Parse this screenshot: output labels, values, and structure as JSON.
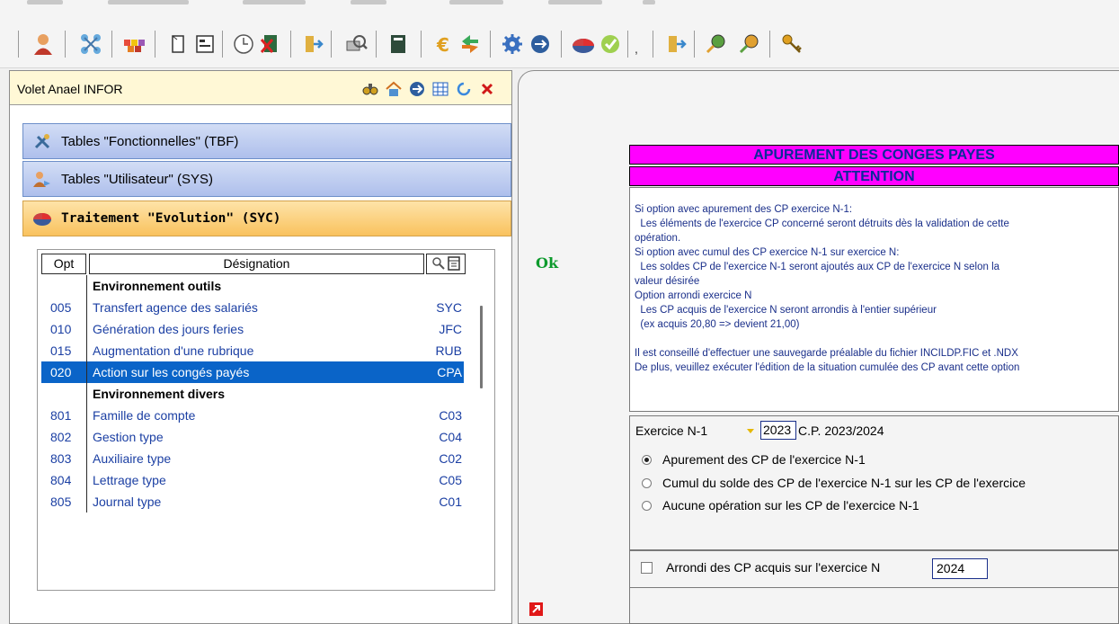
{
  "toolbar": {
    "icons": [
      "user-icon",
      "network-icon",
      "puzzle-icon",
      "document-icon",
      "form-icon",
      "clock-icon",
      "delete-file-icon",
      "export-icon",
      "print-preview-icon",
      "book-icon",
      "euro-icon",
      "arrows-icon",
      "gear-icon",
      "globe-icon",
      "pie-chart-icon",
      "check-icon",
      "export-icon-2",
      "key-magnify-icon",
      "key-magnify-icon-2",
      "key-icon"
    ],
    "comma": ","
  },
  "left_pane": {
    "title": "Volet Anael INFOR",
    "sections": [
      {
        "label": "Tables \"Fonctionnelles\" (TBF)",
        "icon": "tools-icon"
      },
      {
        "label": "Tables \"Utilisateur\" (SYS)",
        "icon": "users-icon"
      },
      {
        "label": "Traitement \"Evolution\" (SYC)",
        "icon": "pie-chart-icon"
      }
    ],
    "grid": {
      "headers": {
        "opt": "Opt",
        "designation": "Désignation"
      },
      "rows": [
        {
          "opt": "",
          "designation": "Environnement outils",
          "code": "",
          "group": true
        },
        {
          "opt": "005",
          "designation": "Transfert agence des salariés",
          "code": "SYC"
        },
        {
          "opt": "010",
          "designation": "Génération des jours feries",
          "code": "JFC"
        },
        {
          "opt": "015",
          "designation": "Augmentation d'une rubrique",
          "code": "RUB"
        },
        {
          "opt": "020",
          "designation": "Action sur les congés payés",
          "code": "CPA",
          "selected": true
        },
        {
          "opt": "",
          "designation": "Environnement divers",
          "code": "",
          "group": true
        },
        {
          "opt": "801",
          "designation": "Famille de compte",
          "code": "C03"
        },
        {
          "opt": "802",
          "designation": "Gestion type",
          "code": "C04"
        },
        {
          "opt": "803",
          "designation": "Auxiliaire type",
          "code": "C02"
        },
        {
          "opt": "804",
          "designation": "Lettrage type",
          "code": "C05"
        },
        {
          "opt": "805",
          "designation": "Journal type",
          "code": "C01"
        }
      ]
    }
  },
  "right_pane": {
    "ok_label": "Ok",
    "title": "APUREMENT DES CONGES PAYES",
    "attention": "ATTENTION",
    "info_lines": [
      "Si option avec apurement des CP exercice N-1:",
      "  Les éléments de l'exercice CP concerné seront détruits dès la validation de cette",
      "opération.",
      "Si option avec cumul des CP exercice N-1 sur exercice N:",
      "  Les soldes CP de l'exercice N-1 seront ajoutés aux CP de l'exercice N selon la",
      "valeur désirée",
      "Option arrondi exercice N",
      "  Les CP acquis de l'exercice N seront arrondis à l'entier supérieur",
      "  (ex acquis 20,80 => devient 21,00)",
      "",
      "Il est conseillé d'effectuer une sauvegarde préalable du fichier INCILDP.FIC et .NDX",
      "De plus, veuillez exécuter l'édition de la situation cumulée des CP avant cette option"
    ],
    "exercice": {
      "label": "Exercice  N-1",
      "value": "2023",
      "cp_label": "C.P. 2023/2024"
    },
    "options": [
      {
        "label": "Apurement des CP de l'exercice N-1",
        "checked": true
      },
      {
        "label": "Cumul du solde des CP de l'exercice N-1 sur les CP de l'exercice",
        "checked": false
      },
      {
        "label": "Aucune opération sur les CP de l'exercice N-1",
        "checked": false
      }
    ],
    "arrondi": {
      "label": "Arrondi des CP acquis sur l'exercice N",
      "value": "2024",
      "checked": false
    }
  }
}
